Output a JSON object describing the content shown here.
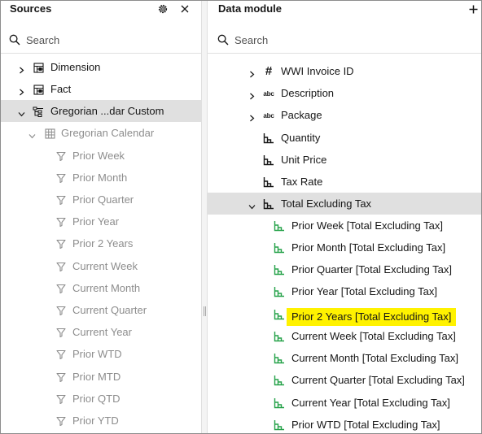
{
  "sources": {
    "title": "Sources",
    "search_placeholder": "Search",
    "tree": [
      {
        "label": "Dimension",
        "icon": "table-group-icon",
        "expanded": false
      },
      {
        "label": "Fact",
        "icon": "table-group-icon",
        "expanded": false
      },
      {
        "label": "Gregorian ...dar Custom",
        "icon": "hierarchy-icon",
        "expanded": true,
        "selected": true
      },
      {
        "label": "Gregorian Calendar",
        "icon": "calendar-table-icon",
        "expanded": true
      },
      {
        "label": "Prior Week",
        "icon": "filter-icon"
      },
      {
        "label": "Prior Month",
        "icon": "filter-icon"
      },
      {
        "label": "Prior Quarter",
        "icon": "filter-icon"
      },
      {
        "label": "Prior Year",
        "icon": "filter-icon"
      },
      {
        "label": "Prior 2 Years",
        "icon": "filter-icon"
      },
      {
        "label": "Current Week",
        "icon": "filter-icon"
      },
      {
        "label": "Current Month",
        "icon": "filter-icon"
      },
      {
        "label": "Current Quarter",
        "icon": "filter-icon"
      },
      {
        "label": "Current Year",
        "icon": "filter-icon"
      },
      {
        "label": "Prior WTD",
        "icon": "filter-icon"
      },
      {
        "label": "Prior MTD",
        "icon": "filter-icon"
      },
      {
        "label": "Prior QTD",
        "icon": "filter-icon"
      },
      {
        "label": "Prior YTD",
        "icon": "filter-icon"
      }
    ]
  },
  "data_module": {
    "title": "Data module",
    "search_placeholder": "Search",
    "tree": [
      {
        "label": "WWI Invoice ID",
        "icon": "hash-icon",
        "expandable": true
      },
      {
        "label": "Description",
        "icon": "abc-icon",
        "expandable": true
      },
      {
        "label": "Package",
        "icon": "abc-icon",
        "expandable": true
      },
      {
        "label": "Quantity",
        "icon": "measure-icon"
      },
      {
        "label": "Unit Price",
        "icon": "measure-icon"
      },
      {
        "label": "Tax Rate",
        "icon": "measure-icon"
      },
      {
        "label": "Total Excluding Tax",
        "icon": "measure-icon",
        "expanded": true,
        "selected": true
      },
      {
        "label": "Prior Week [Total Excluding Tax]",
        "icon": "relative-measure-icon"
      },
      {
        "label": "Prior Month [Total Excluding Tax]",
        "icon": "relative-measure-icon"
      },
      {
        "label": "Prior Quarter [Total Excluding Tax]",
        "icon": "relative-measure-icon"
      },
      {
        "label": "Prior Year [Total Excluding Tax]",
        "icon": "relative-measure-icon"
      },
      {
        "label": "Prior 2 Years [Total Excluding Tax]",
        "icon": "relative-measure-icon",
        "highlighted": true
      },
      {
        "label": "Current Week [Total Excluding Tax]",
        "icon": "relative-measure-icon"
      },
      {
        "label": "Current Month [Total Excluding Tax]",
        "icon": "relative-measure-icon"
      },
      {
        "label": "Current Quarter [Total Excluding Tax]",
        "icon": "relative-measure-icon"
      },
      {
        "label": "Current Year [Total Excluding Tax]",
        "icon": "relative-measure-icon"
      },
      {
        "label": "Prior WTD [Total Excluding Tax]",
        "icon": "relative-measure-icon"
      }
    ]
  },
  "colors": {
    "selected_row": "#e0e0e0",
    "highlight": "#fff200",
    "relative_measure_icon": "#24a148",
    "muted_text": "#8d8d8d"
  }
}
